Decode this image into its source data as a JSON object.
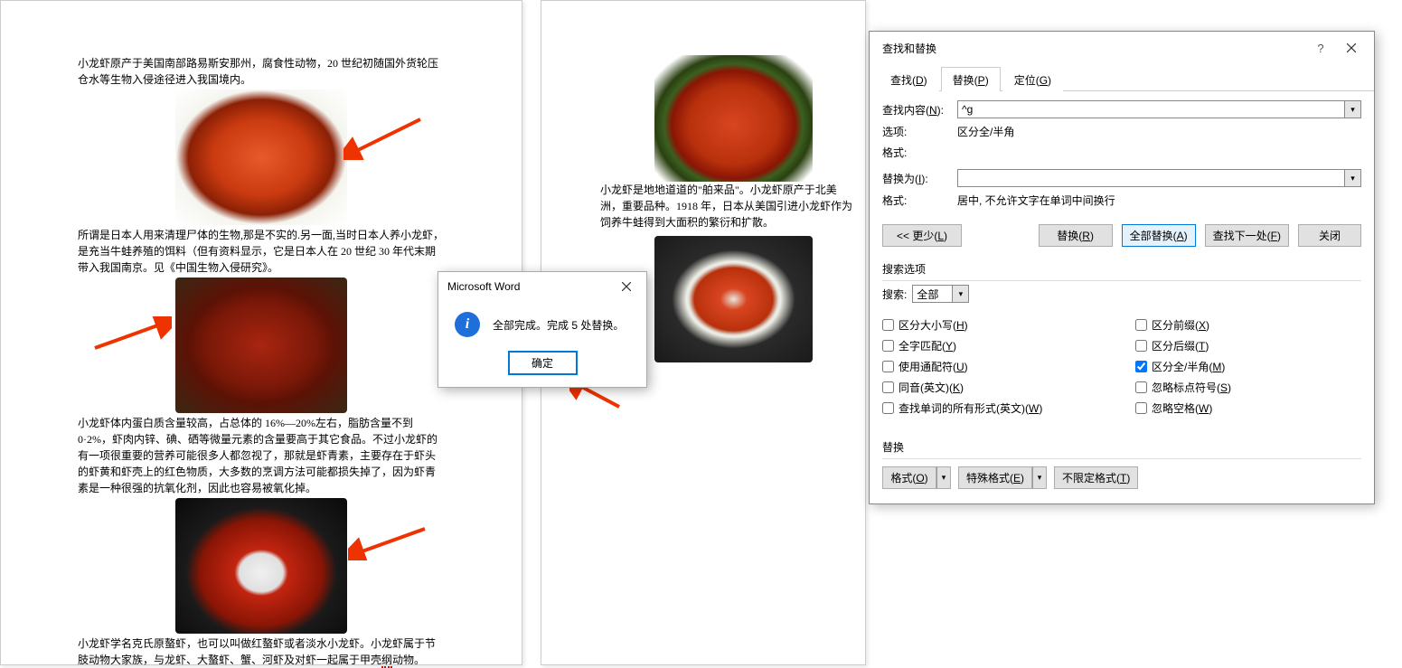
{
  "doc_left": {
    "p1": "小龙虾原产于美国南部路易斯安那州，腐食性动物，20 世纪初随国外货轮压仓水等生物入侵途径进入我国境内。",
    "p2": "所谓是日本人用来清理尸体的生物,那是不实的.另一面,当时日本人养小龙虾，是充当牛蛙养殖的饵料（但有资料显示，它是日本人在 20 世纪 30 年代末期带入我国南京。见《中国生物入侵研究》。",
    "p3": "小龙虾体内蛋白质含量较高，占总体的 16%—20%左右，脂肪含量不到 0·2%，虾肉内锌、碘、硒等微量元素的含量要高于其它食品。不过小龙虾的有一项很重要的营养可能很多人都忽视了，那就是虾青素，主要存在于虾头的虾黄和虾壳上的红色物质，大多数的烹调方法可能都损失掉了，因为虾青素是一种很强的抗氧化剂，因此也容易被氧化掉。",
    "p4_a": "小龙虾学名克氏原螯虾，也可以叫做红螯虾或者淡水小龙虾。小龙虾属于节肢动物大家族，与龙虾、大螯虾、蟹、河虾及对虾一起属于甲壳",
    "p4_b": "纲",
    "p4_c": "动物。"
  },
  "doc_right": {
    "p1": "小龙虾是地地道道的\"舶来品\"。小龙虾原产于北美洲，重要品种。1918 年，日本从美国引进小龙虾作为饲养牛蛙得到大面积的繁衍和扩散。"
  },
  "msg": {
    "title": "Microsoft Word",
    "text": "全部完成。完成 5 处替换。",
    "ok": "确定",
    "icon_letter": "i"
  },
  "dialog": {
    "title": "查找和替换",
    "tabs": {
      "find": "查找(D)",
      "replace": "替换(P)",
      "goto": "定位(G)"
    },
    "find_label": "查找内容(N):",
    "find_value": "^g",
    "options_label": "选项:",
    "options_value": "区分全/半角",
    "format_label": "格式:",
    "replace_label": "替换为(I):",
    "replace_value": "",
    "format2_label": "格式:",
    "format2_value": "居中, 不允许文字在单词中间换行",
    "btn_less": "<< 更少(L)",
    "btn_replace": "替换(R)",
    "btn_replace_all": "全部替换(A)",
    "btn_find_next": "查找下一处(F)",
    "btn_close": "关闭",
    "section_search": "搜索选项",
    "search_label": "搜索:",
    "search_scope": "全部",
    "cb": {
      "match_case": "区分大小写(H)",
      "whole_word": "全字匹配(Y)",
      "wildcards": "使用通配符(U)",
      "sounds_like": "同音(英文)(K)",
      "word_forms": "查找单词的所有形式(英文)(W)",
      "prefix": "区分前缀(X)",
      "suffix": "区分后缀(T)",
      "fullhalf": "区分全/半角(M)",
      "punct": "忽略标点符号(S)",
      "space": "忽略空格(W)"
    },
    "section_replace": "替换",
    "btn_format": "格式(O)",
    "btn_special": "特殊格式(E)",
    "btn_noformat": "不限定格式(T)"
  }
}
